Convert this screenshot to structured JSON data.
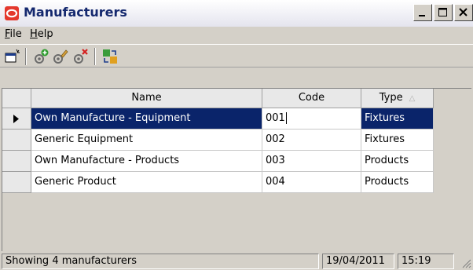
{
  "window": {
    "title": "Manufacturers",
    "accent_color": "#e4382c",
    "title_color": "#14286e"
  },
  "menu": {
    "items": [
      {
        "label": "File",
        "accel": "F",
        "rest": "ile"
      },
      {
        "label": "Help",
        "accel": "H",
        "rest": "elp"
      }
    ]
  },
  "toolbar": {
    "buttons": [
      {
        "icon": "window-properties-icon"
      },
      {
        "icon": "add-manufacturer-icon"
      },
      {
        "icon": "edit-manufacturer-icon"
      },
      {
        "icon": "delete-manufacturer-icon"
      },
      {
        "icon": "refresh-sync-icon"
      }
    ]
  },
  "grid": {
    "columns": [
      {
        "label": "Name"
      },
      {
        "label": "Code"
      },
      {
        "label": "Type",
        "sort": "ascending"
      }
    ],
    "rows": [
      {
        "name": "Own Manufacture - Equipment",
        "code": "001",
        "type": "Fixtures",
        "current": true
      },
      {
        "name": "Generic Equipment",
        "code": "002",
        "type": "Fixtures",
        "current": false
      },
      {
        "name": "Own Manufacture - Products",
        "code": "003",
        "type": "Products",
        "current": false
      },
      {
        "name": "Generic Product",
        "code": "004",
        "type": "Products",
        "current": false
      }
    ],
    "selection_color": "#0a246a"
  },
  "status": {
    "message": "Showing 4 manufacturers",
    "date": "19/04/2011",
    "time": "15:19"
  }
}
